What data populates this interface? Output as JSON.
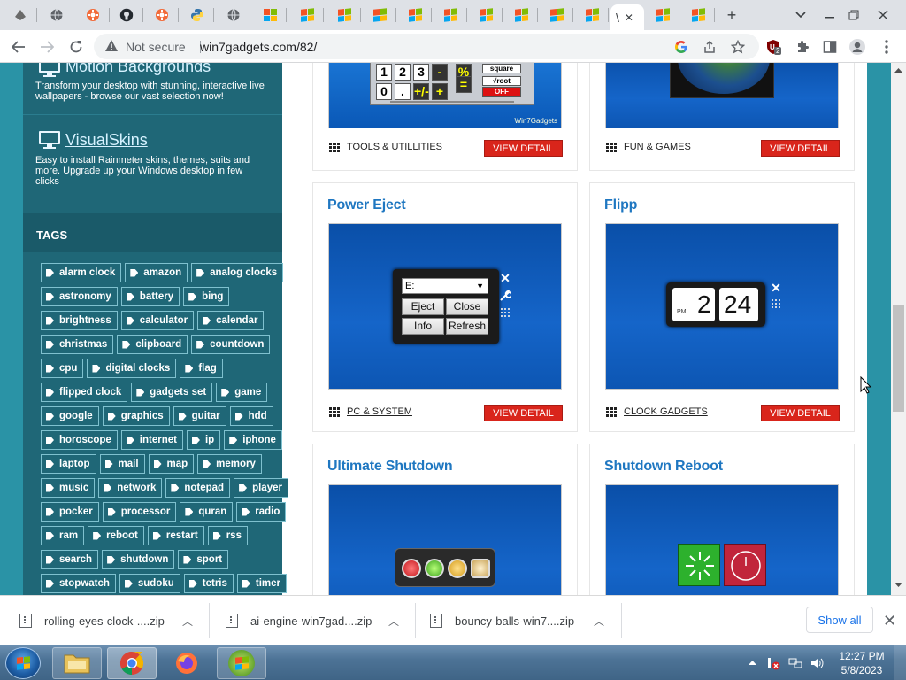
{
  "browser": {
    "tab_count": 20,
    "toolbar": {
      "security_label": "Not secure",
      "url": "win7gadgets.com/82/",
      "extension_badge": "2"
    }
  },
  "sidebar": {
    "promos": [
      {
        "title": "Motion Backgrounds",
        "desc": "Transform your desktop with stunning, interactive live wallpapers - browse our vast selection now!"
      },
      {
        "title": "VisualSkins",
        "desc": "Easy to install Rainmeter skins, themes, suits and more. Upgrade up your Windows desktop in few clicks"
      }
    ],
    "tags_heading": "TAGS",
    "tag_rows": [
      [
        "alarm clock",
        "amazon",
        "analog clocks"
      ],
      [
        "astronomy",
        "battery",
        "bing"
      ],
      [
        "brightness",
        "calculator",
        "calendar"
      ],
      [
        "christmas",
        "clipboard",
        "countdown"
      ],
      [
        "cpu",
        "digital clocks",
        "flag"
      ],
      [
        "flipped clock",
        "gadgets set",
        "game"
      ],
      [
        "google",
        "graphics",
        "guitar",
        "hdd"
      ],
      [
        "horoscope",
        "internet",
        "ip",
        "iphone"
      ],
      [
        "laptop",
        "mail",
        "map",
        "memory"
      ],
      [
        "music",
        "network",
        "notepad",
        "player"
      ],
      [
        "pocker",
        "processor",
        "quran",
        "radio"
      ],
      [
        "ram",
        "reboot",
        "restart",
        "rss"
      ],
      [
        "search",
        "shutdown",
        "sport"
      ],
      [
        "stopwatch",
        "sudoku",
        "tetris",
        "timer"
      ]
    ]
  },
  "cards": {
    "top_left": {
      "category": "TOOLS & UTILLITIES",
      "button": "VIEW DETAIL",
      "calc_keys": [
        "1",
        "2",
        "3",
        "-",
        "%",
        "square",
        "0",
        ".",
        "+/-",
        "+",
        "=",
        "√root",
        "OFF"
      ],
      "brand": "Win7Gadgets"
    },
    "top_right": {
      "category": "FUN & GAMES",
      "button": "VIEW DETAIL"
    },
    "power_eject": {
      "title": "Power Eject",
      "category": "PC & SYSTEM",
      "button": "VIEW DETAIL",
      "drive": "E:",
      "btn_eject": "Eject",
      "btn_close": "Close",
      "btn_info": "Info",
      "btn_refresh": "Refresh"
    },
    "flipp": {
      "title": "Flipp",
      "category": "CLOCK GADGETS",
      "button": "VIEW DETAIL",
      "hour": "2",
      "minute": "24",
      "ampm": "PM"
    },
    "ultimate_shutdown": {
      "title": "Ultimate Shutdown"
    },
    "shutdown_reboot": {
      "title": "Shutdown Reboot"
    }
  },
  "downloads": {
    "items": [
      "rolling-eyes-clock-....zip",
      "ai-engine-win7gad....zip",
      "bouncy-balls-win7....zip"
    ],
    "show_all": "Show all"
  },
  "taskbar": {
    "time": "12:27 PM",
    "date": "5/8/2023"
  },
  "colors": {
    "site_teal": "#2a93a6",
    "sidebar": "#1f6777",
    "accent_blue": "#1f77c1",
    "button_red": "#d9251b"
  }
}
